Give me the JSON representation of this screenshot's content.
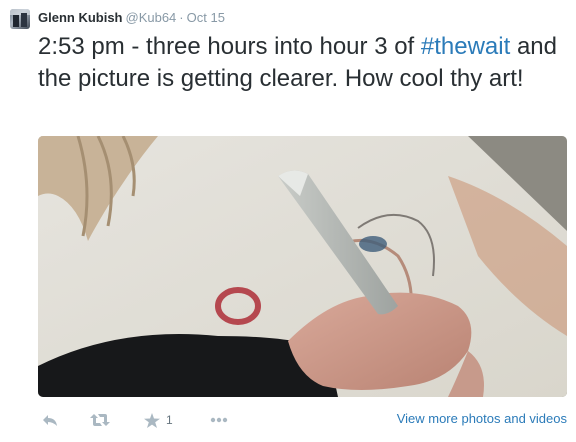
{
  "tweet": {
    "author_name": "Glenn Kubish",
    "handle": "@Kub64",
    "separator": "·",
    "time": "Oct 15",
    "text_before": "2:53 pm - three hours into hour 3 of ",
    "hashtag": "#thewait",
    "text_after": " and the picture is getting clearer. How cool thy art!"
  },
  "media": {
    "alt": "Hand holding a pencil drawing a portrait on paper"
  },
  "actions": {
    "reply_icon": "reply-icon",
    "retweet_icon": "retweet-icon",
    "favorite_icon": "star-icon",
    "favorite_count": "1",
    "more_icon": "ellipsis-icon",
    "view_more_label": "View more photos and videos"
  },
  "colors": {
    "link": "#2b7bb9",
    "text": "#292f33",
    "muted": "#8899a6",
    "icon": "#aab8c2"
  }
}
